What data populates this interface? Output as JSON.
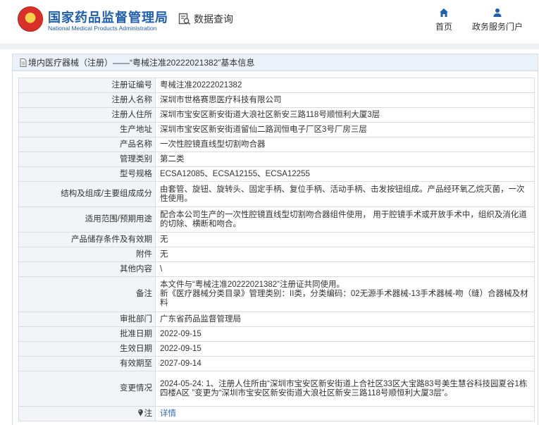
{
  "header": {
    "logo_cn": "国家药品监督管理局",
    "logo_en": "National Medical Products Administration",
    "data_query": "数据查询",
    "nav_home": "首页",
    "nav_gov": "政务服务门户"
  },
  "title_bar": {
    "text": "境内医疗器械（注册）——“粤械注准20222021382”基本信息"
  },
  "rows": [
    {
      "label": "注册证编号",
      "value": "粤械注准20222021382"
    },
    {
      "label": "注册人名称",
      "value": "深圳市世格赛思医疗科技有限公司"
    },
    {
      "label": "注册人住所",
      "value": "深圳市宝安区新安街道大浪社区新安三路118号顺恒利大厦3层"
    },
    {
      "label": "生产地址",
      "value": "深圳市宝安区新安街道留仙二路润恒电子厂区3号厂房三层"
    },
    {
      "label": "产品名称",
      "value": "一次性腔镜直线型切割吻合器"
    },
    {
      "label": "管理类别",
      "value": "第二类"
    },
    {
      "label": "型号规格",
      "value": "ECSA12085、ECSA12155、ECSA12255"
    },
    {
      "label": "结构及组成/主要组成成分",
      "value": "由套管、旋钮、旋转头、固定手柄、复位手柄、活动手柄、击发按钮组成。产品经环氧乙烷灭菌，一次性使用。"
    },
    {
      "label": "适用范围/预期用途",
      "value": "配合本公司生产的一次性腔镜直线型切割吻合器组件使用， 用于腔镜手术或开放手术中，组织及消化道的切除、横断和吻合。"
    },
    {
      "label": "产品储存条件及有效期",
      "value": "无"
    },
    {
      "label": "附件",
      "value": "无"
    },
    {
      "label": "其他内容",
      "value": "\\"
    },
    {
      "label": "备注",
      "value": "本文件与“粤械注准20222021382”注册证共同使用。\n新《医疗器械分类目录》管理类别：II类，分类编码：02无源手术器械-13手术器械-吻（缝）合器械及材料"
    },
    {
      "label": "审批部门",
      "value": "广东省药品监督管理局"
    },
    {
      "label": "批准日期",
      "value": "2022-09-15"
    },
    {
      "label": "生效日期",
      "value": "2022-09-15"
    },
    {
      "label": "有效期至",
      "value": "2027-09-14"
    },
    {
      "label": "变更情况",
      "value": "2024-05-24: 1、注册人住所由“深圳市宝安区新安街道上合社区33区大宝路83号美生慧谷科技园夏谷1栋四楼A区 ”变更为“深圳市宝安区新安街道大浪社区新安三路118号顺恒利大厦3层”。"
    }
  ],
  "note_row": {
    "label": "注",
    "value": "详情"
  }
}
